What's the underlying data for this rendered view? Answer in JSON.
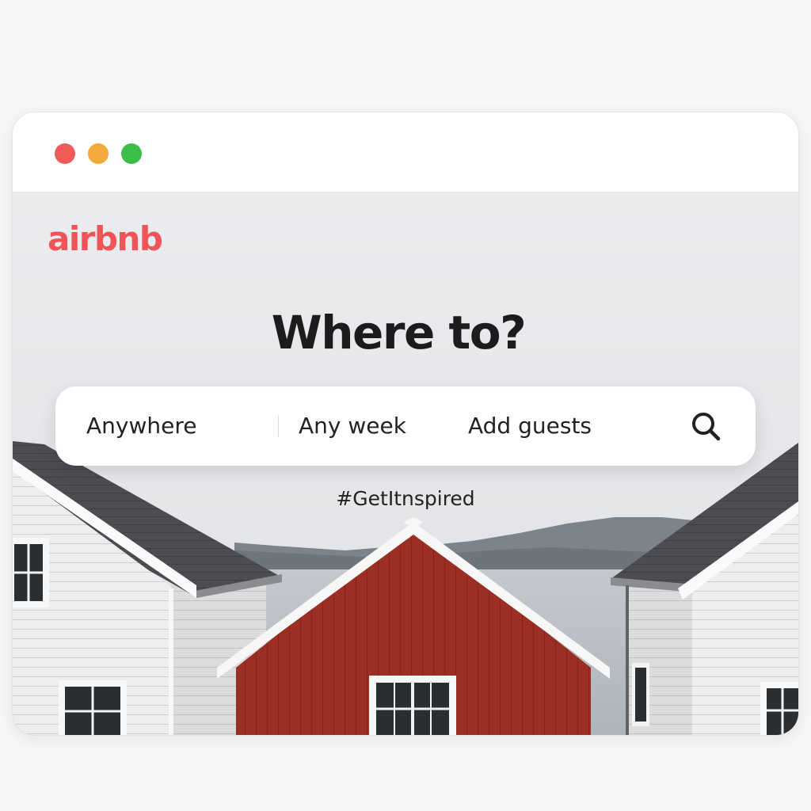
{
  "window": {
    "controls": {
      "close_color": "#f05a57",
      "minimize_color": "#f3a93b",
      "maximize_color": "#3cbf4a"
    }
  },
  "brand": {
    "logo_text": "airbnb",
    "color": "#ef5458"
  },
  "hero": {
    "headline": "Where to?",
    "hashtag": "#GetItnspired"
  },
  "search": {
    "where_label": "Anywhere",
    "when_label": "Any week",
    "who_label": "Add guests",
    "button_icon": "search-icon"
  },
  "colors": {
    "accent": "#ef5458",
    "house_red": "#9a2e22"
  }
}
